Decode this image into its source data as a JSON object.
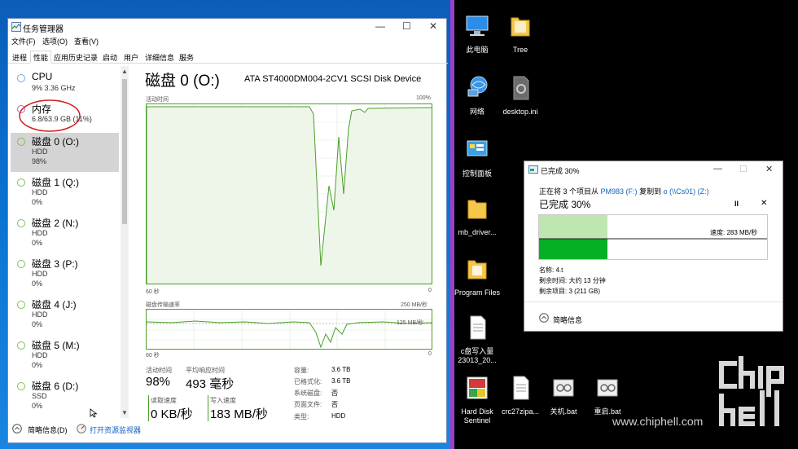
{
  "taskmgr": {
    "title": "任务管理器",
    "menu": [
      "文件(F)",
      "选项(O)",
      "查看(V)"
    ],
    "tabs": [
      "进程",
      "性能",
      "应用历史记录",
      "启动",
      "用户",
      "详细信息",
      "服务"
    ],
    "active_tab": "性能",
    "sidebar": [
      {
        "name": "CPU",
        "sub1": "9% 3.36 GHz",
        "sub2": ""
      },
      {
        "name": "内存",
        "sub1": "6.8/63.9 GB (11%)",
        "sub2": ""
      },
      {
        "name": "磁盘 0 (O:)",
        "sub1": "HDD",
        "sub2": "98%"
      },
      {
        "name": "磁盘 1 (Q:)",
        "sub1": "HDD",
        "sub2": "0%"
      },
      {
        "name": "磁盘 2 (N:)",
        "sub1": "HDD",
        "sub2": "0%"
      },
      {
        "name": "磁盘 3 (P:)",
        "sub1": "HDD",
        "sub2": "0%"
      },
      {
        "name": "磁盘 4 (J:)",
        "sub1": "HDD",
        "sub2": "0%"
      },
      {
        "name": "磁盘 5 (M:)",
        "sub1": "HDD",
        "sub2": "0%"
      },
      {
        "name": "磁盘 6 (D:)",
        "sub1": "SSD",
        "sub2": "0%"
      }
    ],
    "main": {
      "heading": "磁盘 0 (O:)",
      "model": "ATA ST4000DM004-2CV1 SCSI Disk Device",
      "graph1_label": "活动时间",
      "graph1_max": "100%",
      "graph1_left": "60 秒",
      "graph1_right": "0",
      "graph2_label": "磁盘传输速率",
      "graph2_max": "250 MB/秒",
      "graph2_mid": "125 MB/秒",
      "graph2_left": "60 秒",
      "graph2_right": "0",
      "active_time_label": "活动时间",
      "active_time": "98%",
      "resp_label": "平均响应时间",
      "resp": "493 毫秒",
      "read_label": "读取速度",
      "read": "0 KB/秒",
      "write_label": "写入速度",
      "write": "183 MB/秒",
      "kv": [
        {
          "k": "容量:",
          "v": "3.6 TB"
        },
        {
          "k": "已格式化:",
          "v": "3.6 TB"
        },
        {
          "k": "系统磁盘:",
          "v": "否"
        },
        {
          "k": "页面文件:",
          "v": "否"
        },
        {
          "k": "类型:",
          "v": "HDD"
        }
      ]
    },
    "bottom": {
      "less": "简略信息(D)",
      "monitor": "打开资源监视器"
    }
  },
  "desktop": {
    "icons": [
      {
        "label": "此电脑",
        "icon": "computer-icon"
      },
      {
        "label": "Tree",
        "icon": "folder-icon"
      },
      {
        "label": "网络",
        "icon": "network-icon"
      },
      {
        "label": "desktop.ini",
        "icon": "settings-file-icon"
      },
      {
        "label": "控制面板",
        "icon": "control-panel-icon"
      },
      {
        "label": "mb_driver...",
        "icon": "folder-icon"
      },
      {
        "label": "Program Files",
        "icon": "folder-icon"
      },
      {
        "label": "c盘写入量 23013_20...",
        "icon": "document-icon"
      },
      {
        "label": "Hard Disk Sentinel",
        "icon": "hds-icon"
      },
      {
        "label": "crc27zipa...",
        "icon": "document-icon"
      },
      {
        "label": "关机.bat",
        "icon": "bat-icon"
      },
      {
        "label": "重启.bat",
        "icon": "bat-icon"
      }
    ],
    "watermark": "www.chiphell.com"
  },
  "copy_dialog": {
    "title": "已完成 30%",
    "line1_prefix": "正在将 3 个项目从",
    "line1_src": "PM983 (F:)",
    "line1_mid": "复制到",
    "line1_dst": "o (\\\\Cs01) (Z:)",
    "progress_title": "已完成 30%",
    "progress": 0.3,
    "speed": "速度: 283 MB/秒",
    "name": "名称: 4.t",
    "time_left": "剩余时间: 大约 13 分钟",
    "items_left": "剩余项目: 3 (211 GB)",
    "less": "简略信息"
  },
  "colors": {
    "disk_green": "#4a9e2a",
    "accent_blue": "#0a6cd1",
    "progress_green": "#06b025"
  }
}
